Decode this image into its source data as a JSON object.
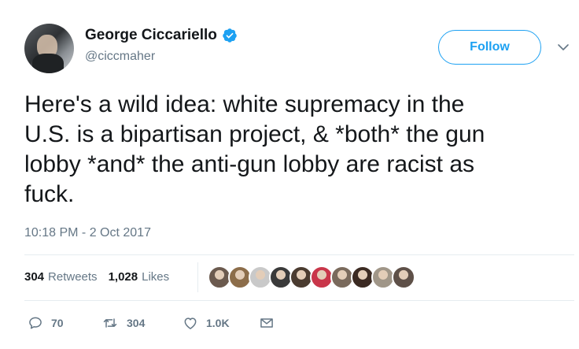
{
  "user": {
    "display_name": "George Ciccariello",
    "handle": "@ciccmaher",
    "verified": true
  },
  "follow_label": "Follow",
  "tweet": {
    "text": "Here's a wild idea: white supremacy in the\nU.S. is a bipartisan project, & *both* the gun\nlobby *and* the anti-gun lobby are racist as\nfuck.",
    "timestamp": "10:18 PM - 2 Oct 2017"
  },
  "stats": {
    "retweets_count": "304",
    "retweets_label": "Retweets",
    "likes_count": "1,028",
    "likes_label": "Likes"
  },
  "likers": [
    "#6b5a4e",
    "#8c6d4a",
    "#c9c9c9",
    "#3a3a3a",
    "#4a3b30",
    "#c9364a",
    "#7a6a5c",
    "#3b2a22",
    "#a09688",
    "#5e5048"
  ],
  "actions": {
    "reply_count": "70",
    "retweet_count": "304",
    "like_count": "1.0K"
  },
  "colors": {
    "accent": "#1da1f2",
    "secondary_text": "#657786"
  }
}
